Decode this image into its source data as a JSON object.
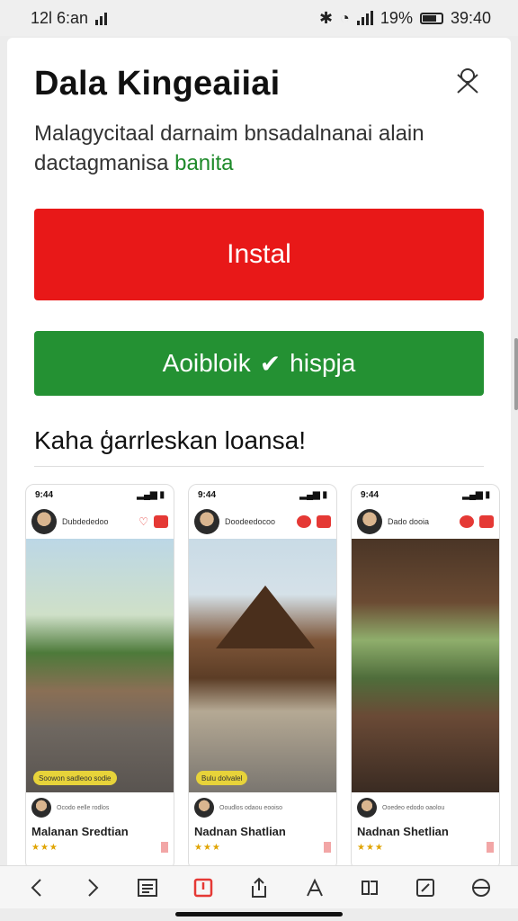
{
  "status_bar": {
    "time": "12l 6:an",
    "battery": "19%",
    "clock": "39:40"
  },
  "sheet": {
    "title": "Dala Kingeaiiai",
    "description_part1": "Malagycitaal darnaim bnsadalnanai alain dactagmanisa",
    "description_part2": "banita",
    "install_label": "Instal",
    "verify_label": "Aoibloik",
    "verify_label2": "hispja",
    "section_heading": "Kaha ģarrleskan loansa!"
  },
  "screenshots": [
    {
      "time": "9:44",
      "header_name": "Dubdededoo",
      "tag": "Soowon sadleoo sodie",
      "footer_small": "Ocodo eelle rodlos",
      "name": "Malanan Sredtian",
      "stars": "★★★"
    },
    {
      "time": "9:44",
      "header_name": "Doodeedocoo",
      "tag": "Bulu dolvalel",
      "footer_small": "Ooudlos odaou eooiso",
      "name": "Nadnan Shatlian",
      "stars": "★★★"
    },
    {
      "time": "9:44",
      "header_name": "Dado dooia",
      "tag": "",
      "footer_small": "Ooedeo edodo oaolou",
      "name": "Nadnan Shetlian",
      "stars": "★★★"
    }
  ],
  "toolbar": {
    "icons": [
      "back-icon",
      "forward-icon",
      "list-icon",
      "book-icon",
      "share-icon",
      "text-icon",
      "translate-icon",
      "edit-icon",
      "globe-icon"
    ]
  },
  "colors": {
    "install": "#e81818",
    "verify": "#249133",
    "accent_green": "#1e8a2a"
  }
}
